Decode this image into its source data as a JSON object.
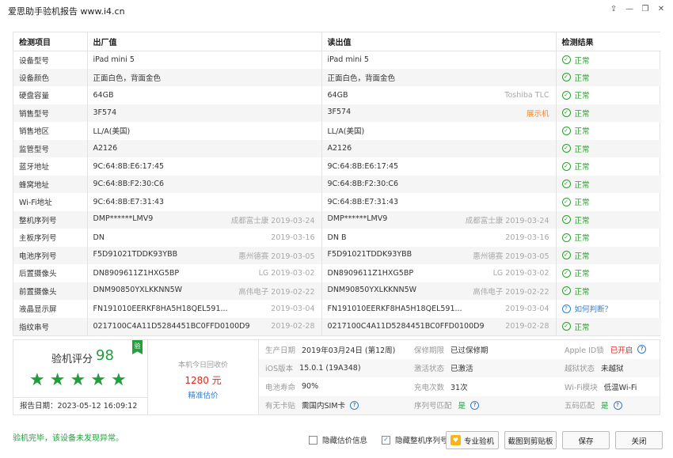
{
  "window": {
    "title": "爱思助手验机报告 www.i4.cn",
    "icons": [
      "share-icon",
      "minimize-icon",
      "restore-icon",
      "close-icon"
    ]
  },
  "table": {
    "headers": [
      "检测项目",
      "出厂值",
      "读出值",
      "检测结果"
    ],
    "rows": [
      {
        "item": "设备型号",
        "factory": "iPad mini 5",
        "factory_side": "",
        "read": "iPad mini 5",
        "read_side": "",
        "result": "正常"
      },
      {
        "item": "设备颜色",
        "factory": "正面白色，背面金色",
        "factory_side": "",
        "read": "正面白色，背面金色",
        "read_side": "",
        "result": "正常"
      },
      {
        "item": "硬盘容量",
        "factory": "64GB",
        "factory_side": "",
        "read": "64GB",
        "read_side": "Toshiba TLC",
        "result": "正常"
      },
      {
        "item": "销售型号",
        "factory": "3F574",
        "factory_side": "",
        "read": "3F574",
        "read_side": "展示机",
        "result": "正常"
      },
      {
        "item": "销售地区",
        "factory": "LL/A(美国)",
        "factory_side": "",
        "read": "LL/A(美国)",
        "read_side": "",
        "result": "正常"
      },
      {
        "item": "监管型号",
        "factory": "A2126",
        "factory_side": "",
        "read": "A2126",
        "read_side": "",
        "result": "正常"
      },
      {
        "item": "蓝牙地址",
        "factory": "9C:64:8B:E6:17:45",
        "factory_side": "",
        "read": "9C:64:8B:E6:17:45",
        "read_side": "",
        "result": "正常"
      },
      {
        "item": "蜂窝地址",
        "factory": "9C:64:8B:F2:30:C6",
        "factory_side": "",
        "read": "9C:64:8B:F2:30:C6",
        "read_side": "",
        "result": "正常"
      },
      {
        "item": "Wi-Fi地址",
        "factory": "9C:64:8B:E7:31:43",
        "factory_side": "",
        "read": "9C:64:8B:E7:31:43",
        "read_side": "",
        "result": "正常"
      },
      {
        "item": "整机序列号",
        "factory": "DMP******LMV9",
        "factory_side": "成都富士康  2019-03-24",
        "read": "DMP******LMV9",
        "read_side": "成都富士康  2019-03-24",
        "result": "正常"
      },
      {
        "item": "主板序列号",
        "factory": "DN",
        "factory_side": "2019-03-16",
        "read": "DN                          B",
        "read_side": "2019-03-16",
        "result": "正常"
      },
      {
        "item": "电池序列号",
        "factory": "F5D91021TDDK93YBB",
        "factory_side": "惠州德赛  2019-03-05",
        "read": "F5D91021TDDK93YBB",
        "read_side": "惠州德赛  2019-03-05",
        "result": "正常"
      },
      {
        "item": "后置摄像头",
        "factory": "DN8909611Z1HXG5BP",
        "factory_side": "LG  2019-03-02",
        "read": "DN8909611Z1HXG5BP",
        "read_side": "LG  2019-03-02",
        "result": "正常"
      },
      {
        "item": "前置摄像头",
        "factory": "DNM90850YXLKKNN5W",
        "factory_side": "高伟电子  2019-02-22",
        "read": "DNM90850YXLKKNN5W",
        "read_side": "高伟电子  2019-02-22",
        "result": "正常"
      },
      {
        "item": "液晶显示屏",
        "factory": "FN191010EERKF8HA5H18QEL591...",
        "factory_side": "2019-03-04",
        "read": "FN191010EERKF8HA5H18QEL591...",
        "read_side": "2019-03-04",
        "result": "如何判断？"
      },
      {
        "item": "指纹串号",
        "factory": "0217100C4A11D5284451BC0FFD0100D9",
        "factory_side": "2019-02-28",
        "read": "0217100C4A11D5284451BC0FFD0100D9",
        "read_side": "2019-02-28",
        "result": "正常"
      }
    ]
  },
  "score": {
    "label": "验机评分",
    "value": "98",
    "badge": "验",
    "stars": 5,
    "report_date": "报告日期：2023-05-12 16:09:12"
  },
  "recycle": {
    "label": "本机今日回收价",
    "price": "1280 元",
    "link": "精准估价"
  },
  "info": [
    {
      "k": "生产日期",
      "v": "2019年03月24日 (第12周)"
    },
    {
      "k": "保修期限",
      "v": "已过保修期"
    },
    {
      "k": "Apple ID锁",
      "v": "已开启"
    },
    {
      "k": "iOS版本",
      "v": "15.0.1 (19A348)"
    },
    {
      "k": "激活状态",
      "v": "已激活"
    },
    {
      "k": "越狱状态",
      "v": "未越狱"
    },
    {
      "k": "电池寿命",
      "v": "90%"
    },
    {
      "k": "充电次数",
      "v": "31次"
    },
    {
      "k": "Wi-Fi模块",
      "v": "低温Wi-Fi"
    },
    {
      "k": "有无卡贴",
      "v": "需国内SIM卡"
    },
    {
      "k": "序列号匹配",
      "v": "是"
    },
    {
      "k": "五码匹配",
      "v": "是"
    }
  ],
  "footer": {
    "message": "验机完毕，该设备未发现异常。",
    "hide_price": "隐藏估价信息",
    "hide_serial": "隐藏整机序列号",
    "hide_serial_checked": true,
    "pro_button": "专业验机",
    "clip_button": "截图到剪贴板",
    "save_button": "保存",
    "close_button": "关闭"
  },
  "colors": {
    "ok_green": "#27a127",
    "red": "#e1261c",
    "link_blue": "#2e7ed6",
    "orange": "#f08a2c"
  }
}
